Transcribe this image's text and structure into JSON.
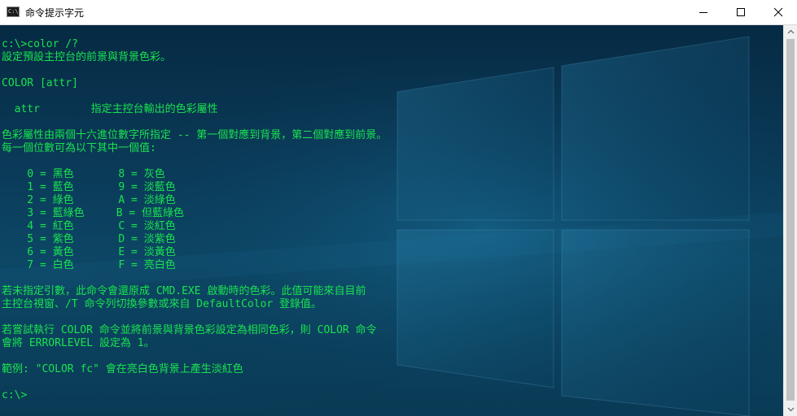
{
  "window": {
    "title": "命令提示字元",
    "icon_text": "C:\\."
  },
  "terminal": {
    "lines": [
      "c:\\>color /?",
      "設定預設主控台的前景與背景色彩。",
      "",
      "COLOR [attr]",
      "",
      "  attr        指定主控台輸出的色彩屬性",
      "",
      "色彩屬性由兩個十六進位數字所指定 -- 第一個對應到背景，第二個對應到前景。",
      "每一個位數可為以下其中一個值:",
      "",
      "    0 = 黑色       8 = 灰色",
      "    1 = 藍色       9 = 淡藍色",
      "    2 = 綠色       A = 淡綠色",
      "    3 = 藍綠色     B = 但藍綠色",
      "    4 = 紅色       C = 淡紅色",
      "    5 = 紫色       D = 淡紫色",
      "    6 = 黃色       E = 淡黃色",
      "    7 = 白色       F = 亮白色",
      "",
      "若未指定引數，此命令會還原成 CMD.EXE 啟動時的色彩。此值可能來自目前",
      "主控台視窗、/T 命令列切換參數或來自 DefaultColor 登錄值。",
      "",
      "若嘗試執行 COLOR 命令並將前景與背景色彩設定為相同色彩，則 COLOR 命令",
      "會將 ERRORLEVEL 設定為 1。",
      "",
      "範例: \"COLOR fc\" 會在亮白色背景上產生淡紅色",
      "",
      "c:\\>"
    ]
  },
  "colors": {
    "text": "#19e34f",
    "background": "#0a3a55",
    "titlebar": "#ffffff"
  },
  "icons": {
    "minimize": "minimize-icon",
    "maximize": "maximize-icon",
    "close": "close-icon",
    "scroll_up": "scroll-up-arrow-icon",
    "scroll_down": "scroll-down-arrow-icon"
  }
}
